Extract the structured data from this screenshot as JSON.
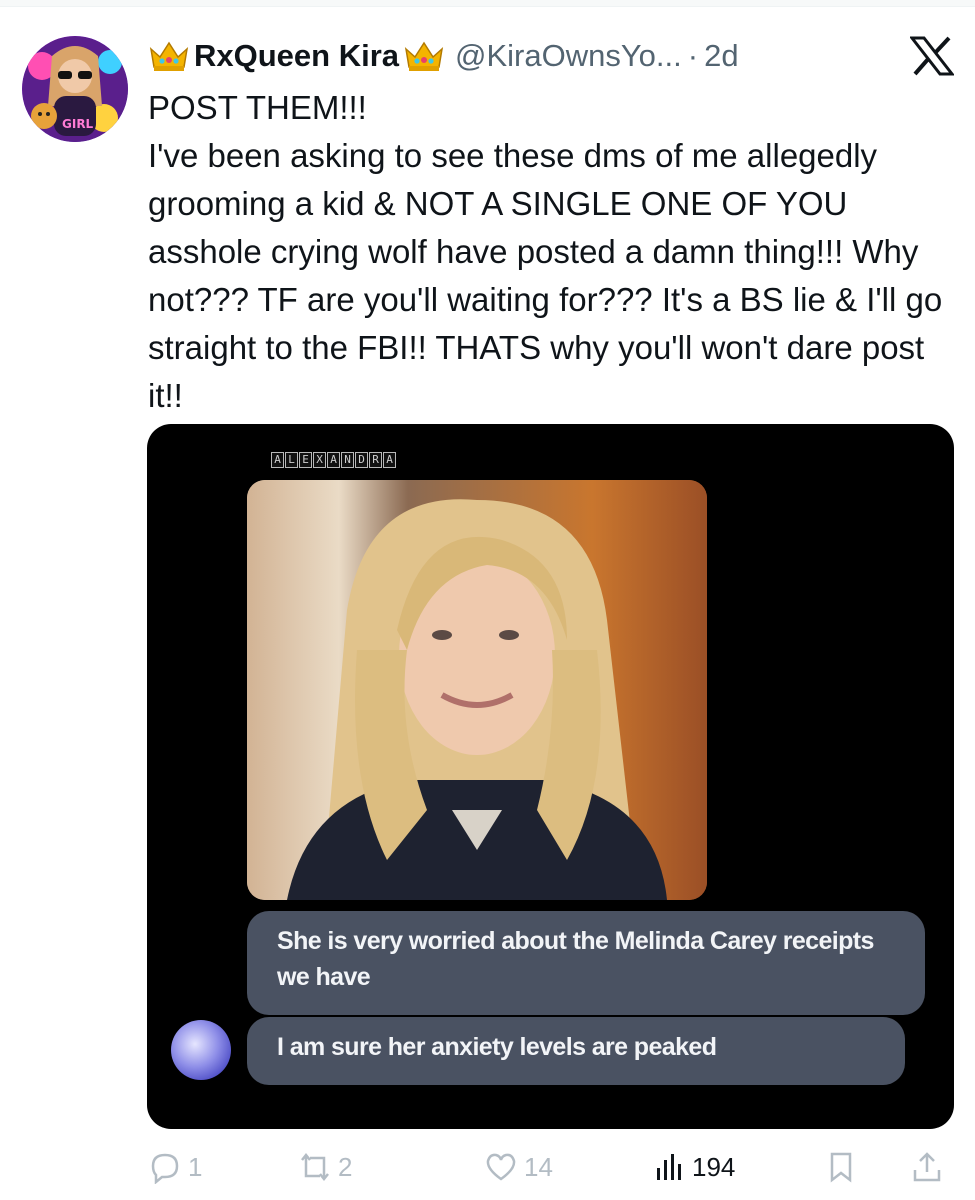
{
  "author": {
    "display_name": "RxQueen Kira",
    "handle": "@KiraOwnsYo...",
    "separator": "·",
    "time": "2d",
    "avatar_icon": "profile-avatar-icon"
  },
  "post": {
    "lines": [
      "POST THEM!!!",
      "I've been asking to see these dms of me allegedly grooming a kid & NOT A SINGLE ONE OF YOU asshole crying wolf have posted a damn thing!!! Why not??? TF are you'll waiting for??? It's a BS lie & I'll go straight to the FBI!! THATS why you'll won't dare post it!!"
    ]
  },
  "media": {
    "sender_name": [
      "A",
      "L",
      "E",
      "X",
      "A",
      "N",
      "D",
      "R",
      "A"
    ],
    "messages": [
      "She is very worried about the Melinda Carey receipts we have",
      "I am sure her anxiety levels are peaked"
    ]
  },
  "actions": {
    "replies": "1",
    "reposts": "2",
    "likes": "14",
    "views": "194"
  },
  "colors": {
    "text": "#0f1419",
    "muted": "#536471",
    "bubble": "#4a5262",
    "icons": "#b3bcc4"
  }
}
